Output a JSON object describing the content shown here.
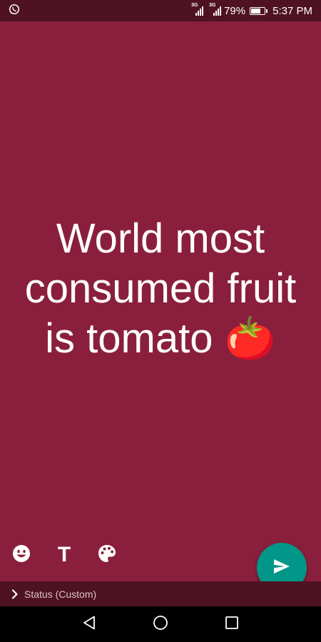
{
  "status_bar": {
    "app_icon": "whatsapp-icon",
    "sim1_label": "3G",
    "sim2_label": "3G",
    "battery_percent": "79%",
    "battery_level": 0.79,
    "time": "5:37 PM"
  },
  "composer": {
    "background_color": "#8a1f3d",
    "text_line_1": "World most",
    "text_line_2": "consumed fruit",
    "text_line_3": "is tomato 🍅"
  },
  "toolbar": {
    "emoji_icon": "emoji-icon",
    "text_tool_label": "T",
    "palette_icon": "palette-icon",
    "send_icon": "send-icon",
    "send_color": "#009688"
  },
  "recipient": {
    "label": "Status (Custom)"
  },
  "nav": {
    "back_icon": "back-triangle-icon",
    "home_icon": "home-circle-icon",
    "recents_icon": "recents-square-icon"
  }
}
